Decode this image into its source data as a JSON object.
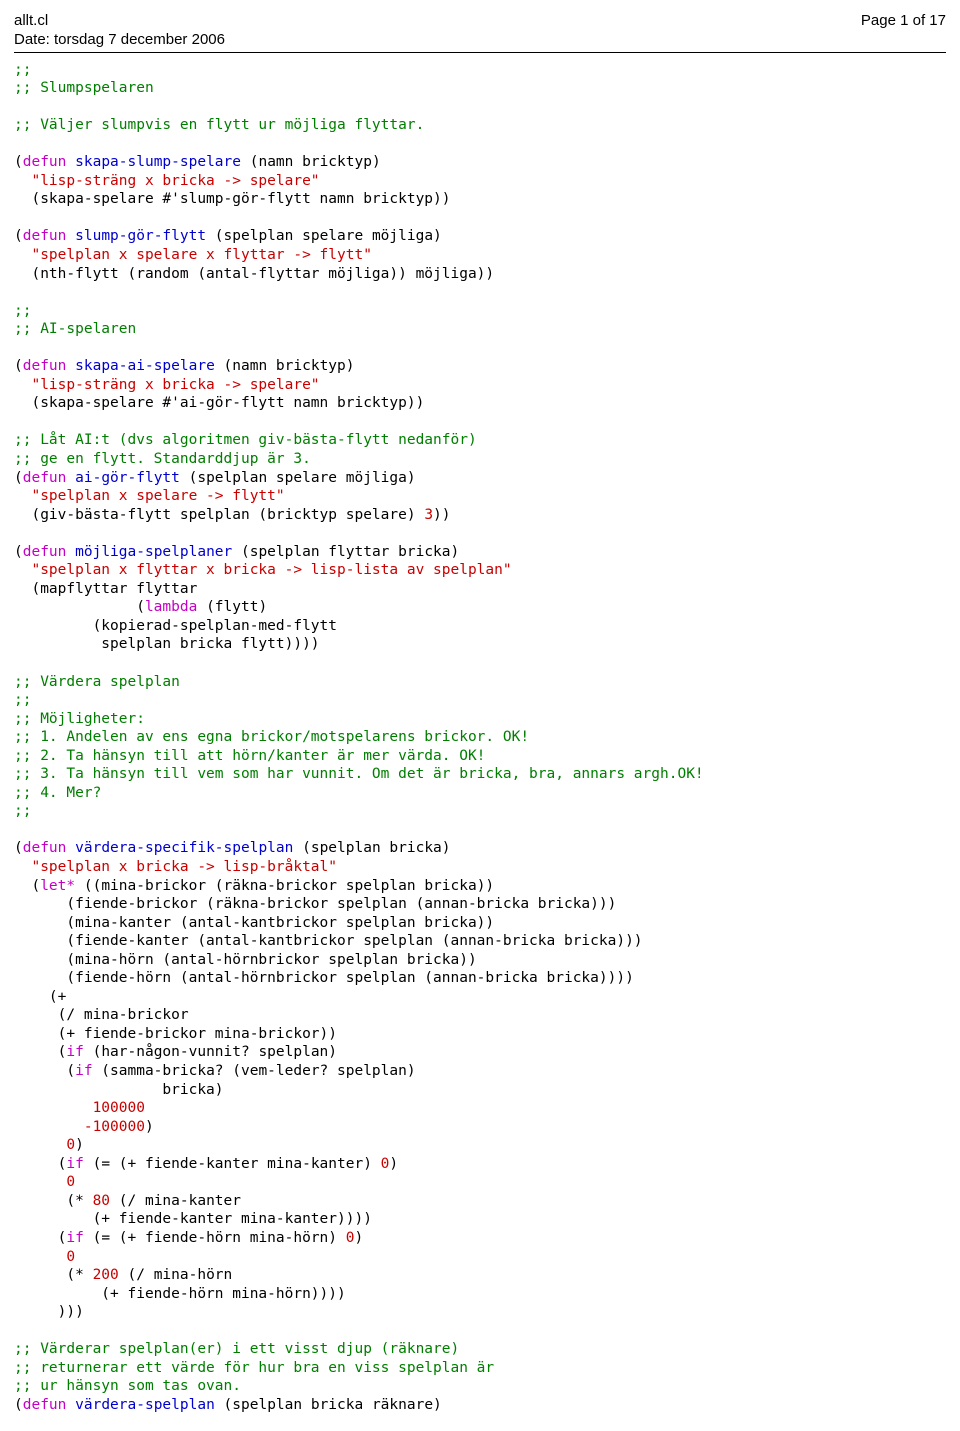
{
  "header": {
    "filename": "allt.cl",
    "date_label": "Date: torsdag 7 december 2006",
    "page_label": "Page 1 of 17"
  },
  "code": {
    "c1": ";;",
    "c2": ";; Slumpspelaren",
    "c3": ";; Väljer slumpvis en flytt ur möjliga flyttar.",
    "defun": "defun",
    "fn_skapa_slump": "skapa-slump-spelare",
    "s1": "  \"lisp-sträng x bricka -> spelare\"",
    "sk_slump_body": "  (skapa-spelare #'slump-gör-flytt namn bricktyp))",
    "fn_slump_gor": "slump-gör-flytt",
    "s2": "  \"spelplan x spelare x flyttar -> flytt\"",
    "slump_body": "  (nth-flytt (random (antal-flyttar möjliga)) möjliga))",
    "c4": ";;",
    "c5": ";; AI-spelaren",
    "fn_skapa_ai": "skapa-ai-spelare",
    "s3": "  \"lisp-sträng x bricka -> spelare\"",
    "sk_ai_body": "  (skapa-spelare #'ai-gör-flytt namn bricktyp))",
    "c6": ";; Låt AI:t (dvs algoritmen giv-bästa-flytt nedanför)",
    "c7": ";; ge en flytt. Standarddjup är 3.",
    "fn_ai_gor": "ai-gör-flytt",
    "s4": "  \"spelplan x spelare -> flytt\"",
    "ai_body_a": "  (giv-bästa-flytt spelplan (bricktyp spelare) ",
    "ai_body_b": "))",
    "n3": "3",
    "fn_mojliga": "möjliga-spelplaner",
    "s5": "  \"spelplan x flyttar x bricka -> lisp-lista av spelplan\"",
    "moj_body1": "  (mapflyttar flyttar",
    "moj_body2": "              (",
    "lambda": "lambda",
    "moj_body2b": " (flytt)",
    "moj_body3": "         (kopierad-spelplan-med-flytt",
    "moj_body4": "          spelplan bricka flytt))))",
    "c8": ";; Värdera spelplan",
    "c9": ";;",
    "c10": ";; Möjligheter:",
    "c11": ";; 1. Andelen av ens egna brickor/motspelarens brickor. OK!",
    "c12": ";; 2. Ta hänsyn till att hörn/kanter är mer värda. OK!",
    "c13": ";; 3. Ta hänsyn till vem som har vunnit. Om det är bricka, bra, annars argh.OK!",
    "c14": ";; 4. Mer?",
    "c15": ";;",
    "fn_vardera_spec": "värdera-specifik-spelplan",
    "s6": "  \"spelplan x bricka -> lisp-bråktal\"",
    "letstar": "let*",
    "vs1": " ((mina-brickor (räkna-brickor spelplan bricka))",
    "vs2": "      (fiende-brickor (räkna-brickor spelplan (annan-bricka bricka)))",
    "vs3": "      (mina-kanter (antal-kantbrickor spelplan bricka))",
    "vs4": "      (fiende-kanter (antal-kantbrickor spelplan (annan-bricka bricka)))",
    "vs5": "      (mina-hörn (antal-hörnbrickor spelplan bricka))",
    "vs6": "      (fiende-hörn (antal-hörnbrickor spelplan (annan-bricka bricka))))",
    "vs7": "    (+",
    "vs8": "     (/ mina-brickor",
    "vs9": "     (+ fiende-brickor mina-brickor))",
    "if": "if",
    "vs10": " (har-någon-vunnit? spelplan)",
    "vs11": " (samma-bricka? (vem-leder? spelplan)",
    "vs12": "                 bricka)",
    "n100000a": "         100000",
    "n100000b": "        -100000",
    "vs13": ")",
    "n0a": "      0",
    "vs14": ")",
    "vs15a": " (= (+ fiende-kanter mina-kanter) ",
    "n0b": "0",
    "vs15b": ")",
    "vs16": "      0",
    "n80": "80",
    "vs17": " (/ mina-kanter",
    "vs18": "         (+ fiende-kanter mina-kanter))))",
    "vs19a": " (= (+ fiende-hörn mina-hörn) ",
    "vs19b": ")",
    "vs20": "      0",
    "n200": "200",
    "vs21": " (/ mina-hörn",
    "vs22": "          (+ fiende-hörn mina-hörn))))",
    "vs23": "     )))",
    "c16": ";; Värderar spelplan(er) i ett visst djup (räknare)",
    "c17": ";; returnerar ett värde för hur bra en viss spelplan är",
    "c18": ";; ur hänsyn som tas ovan.",
    "fn_vardera": "värdera-spelplan",
    "args_skapa_slump": " (namn bricktyp)",
    "args_slump_gor": " (spelplan spelare möjliga)",
    "args_skapa_ai": " (namn bricktyp)",
    "args_ai_gor": " (spelplan spelare möjliga)",
    "args_mojliga": " (spelplan flyttar bricka)",
    "args_vardera_spec": " (spelplan bricka)",
    "args_vardera": " (spelplan bricka räknare)"
  }
}
